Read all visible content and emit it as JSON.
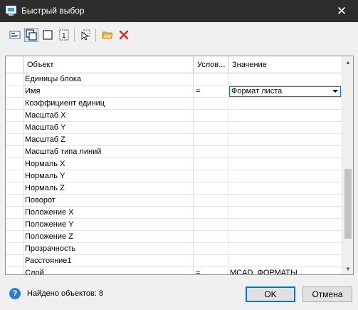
{
  "window": {
    "title": "Быстрый выбор",
    "close_symbol": "✕"
  },
  "toolbar": {
    "icons": [
      "select-all-icon",
      "select-window-icon",
      "select-box-icon",
      "numbered-list-icon",
      "pointer-select-icon",
      "folder-open-icon",
      "delete-red-x-icon"
    ],
    "active_index": 1,
    "delete_color": "#d9261c",
    "folder_color": "#e8b840"
  },
  "grid": {
    "headers": {
      "object": "Объект",
      "condition": "Услов...",
      "value": "Значение"
    },
    "rows": [
      {
        "object": "Единицы блока",
        "condition": "",
        "value": ""
      },
      {
        "object": "Имя",
        "condition": "=",
        "value": "Формат листа",
        "selected": true
      },
      {
        "object": "Коэффициент единиц",
        "condition": "",
        "value": ""
      },
      {
        "object": "Масштаб X",
        "condition": "",
        "value": ""
      },
      {
        "object": "Масштаб Y",
        "condition": "",
        "value": ""
      },
      {
        "object": "Масштаб Z",
        "condition": "",
        "value": ""
      },
      {
        "object": "Масштаб типа линий",
        "condition": "",
        "value": ""
      },
      {
        "object": "Нормаль X",
        "condition": "",
        "value": ""
      },
      {
        "object": "Нормаль Y",
        "condition": "",
        "value": ""
      },
      {
        "object": "Нормаль Z",
        "condition": "",
        "value": ""
      },
      {
        "object": "Поворот",
        "condition": "",
        "value": ""
      },
      {
        "object": "Положение X",
        "condition": "",
        "value": ""
      },
      {
        "object": "Положение Y",
        "condition": "",
        "value": ""
      },
      {
        "object": "Положение Z",
        "condition": "",
        "value": ""
      },
      {
        "object": "Прозрачность",
        "condition": "",
        "value": ""
      },
      {
        "object": "Расстояние1",
        "condition": "",
        "value": ""
      },
      {
        "object": "Слой",
        "condition": "=",
        "value": "MCAD_ФОРМАТЫ"
      }
    ]
  },
  "status": {
    "found_text": "Найдено объектов: 8",
    "help_symbol": "?"
  },
  "buttons": {
    "ok": "OK",
    "cancel": "Отмена"
  },
  "colors": {
    "titlebar": "#2d2d2d",
    "accent": "#0078d7"
  }
}
